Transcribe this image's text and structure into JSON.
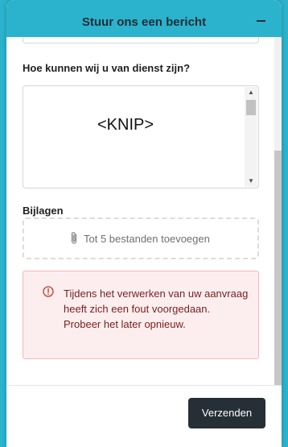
{
  "header": {
    "title": "Stuur ons een bericht",
    "collapse_icon": "minus-icon"
  },
  "form": {
    "question_label": "Hoe kunnen wij u van dienst zijn?",
    "message_value": "<KNIP>",
    "attachments_label": "Bijlagen",
    "attachments_placeholder": "Tot 5 bestanden toevoegen",
    "attachments_icon": "paperclip-icon"
  },
  "error": {
    "icon": "alert-circle-icon",
    "message": "Tijdens het verwerken van uw aanvraag heeft zich een fout voorgedaan. Probeer het later opnieuw."
  },
  "footer": {
    "send_label": "Verzenden"
  },
  "colors": {
    "accent": "#2bb3cd",
    "button_dark": "#262f36",
    "error_bg": "#fceeee",
    "error_border": "#f1b8b8",
    "error_text": "#7a1d1d"
  }
}
